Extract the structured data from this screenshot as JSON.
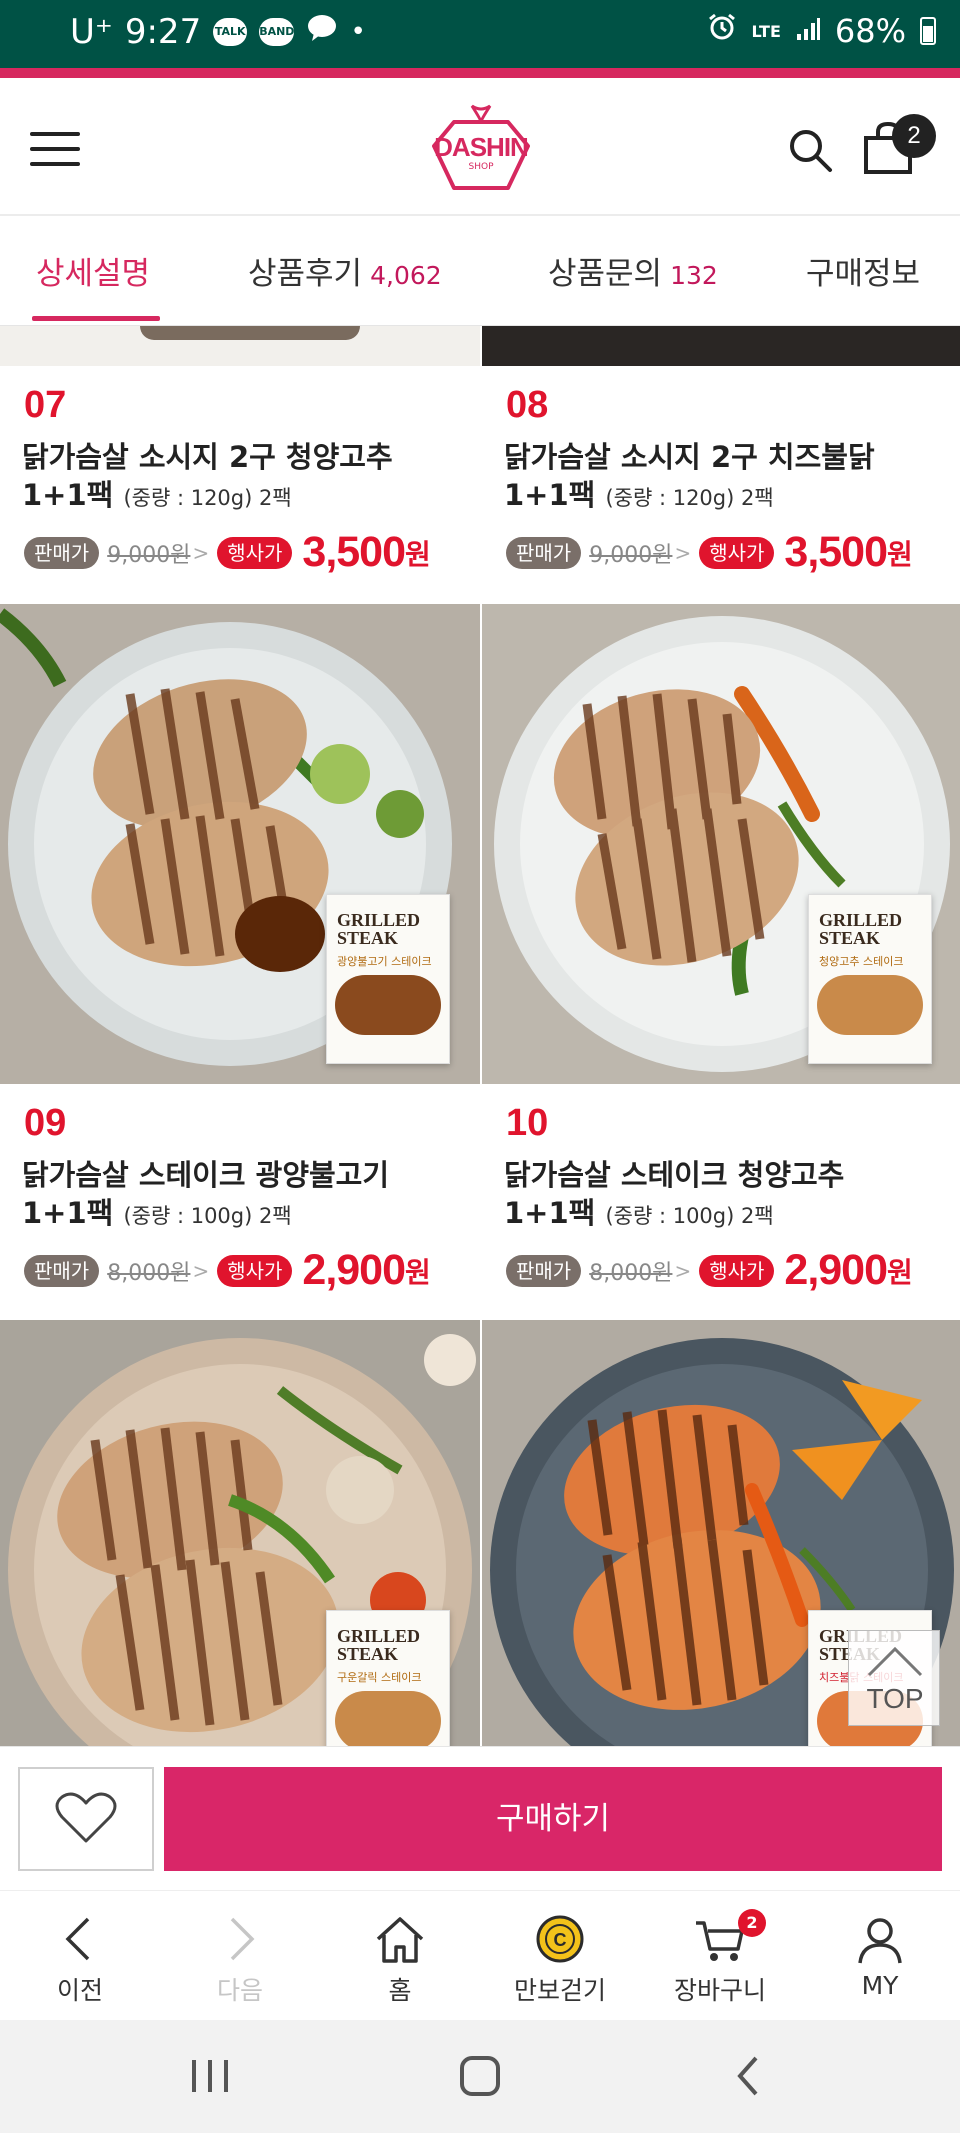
{
  "status_bar": {
    "carrier": "U⁺",
    "time": "9:27",
    "notif_chip_1": "TALK",
    "notif_chip_2": "BAND",
    "dot": "•",
    "network": "LTE",
    "battery": "68%",
    "icons": [
      "talk-icon",
      "band-icon",
      "chat-bubble-icon",
      "alarm-icon",
      "signal-icon",
      "battery-icon"
    ],
    "bg_color": "#005245"
  },
  "header": {
    "logo_text": "DASHIN",
    "logo_sub": "SHOP",
    "cart_count": "2",
    "icons": [
      "menu-icon",
      "search-icon",
      "shopping-bag-icon"
    ],
    "brand_color": "#d6285f"
  },
  "tabs": [
    {
      "label": "상세설명",
      "count": "",
      "active": true
    },
    {
      "label": "상품후기",
      "count": "4,062",
      "active": false
    },
    {
      "label": "상품문의",
      "count": "132",
      "active": false
    },
    {
      "label": "구매정보",
      "count": "",
      "active": false
    }
  ],
  "products": [
    {
      "number": "07",
      "name_line1": "닭가슴살 소시지 2구 청양고추",
      "name_line2": "1+1팩",
      "weight": "(중량 : 120g) 2팩",
      "tag_orig": "판매가",
      "orig_price": "9,000원",
      "tag_sale": "행사가",
      "sale_price": "3,500",
      "unit": "원"
    },
    {
      "number": "08",
      "name_line1": "닭가슴살 소시지 2구 치즈불닭",
      "name_line2": "1+1팩",
      "weight": "(중량 : 120g) 2팩",
      "tag_orig": "판매가",
      "orig_price": "9,000원",
      "tag_sale": "행사가",
      "sale_price": "3,500",
      "unit": "원"
    },
    {
      "number": "09",
      "name_line1": "닭가슴살 스테이크 광양불고기",
      "name_line2": "1+1팩",
      "weight": "(중량 : 100g) 2팩",
      "tag_orig": "판매가",
      "orig_price": "8,000원",
      "tag_sale": "행사가",
      "sale_price": "2,900",
      "unit": "원"
    },
    {
      "number": "10",
      "name_line1": "닭가슴살 스테이크 청양고추",
      "name_line2": "1+1팩",
      "weight": "(중량 : 100g) 2팩",
      "tag_orig": "판매가",
      "orig_price": "8,000원",
      "tag_sale": "행사가",
      "sale_price": "2,900",
      "unit": "원"
    }
  ],
  "product_images": [
    {
      "brand": "GRILLED STEAK",
      "flavor": "광양불고기 스테이크"
    },
    {
      "brand": "GRILLED STEAK",
      "flavor": "청양고추 스테이크"
    },
    {
      "brand": "GRILLED STEAK",
      "flavor": "구운갈릭 스테이크"
    },
    {
      "brand": "GRILLED STEAK",
      "flavor": "치즈불닭 스테이크"
    }
  ],
  "top_button": "TOP",
  "buy_bar": {
    "buy_label": "구매하기",
    "buy_color": "#d92668",
    "wish_icon": "heart-icon"
  },
  "bottom_nav": [
    {
      "label": "이전",
      "icon": "chevron-left-icon",
      "enabled": true
    },
    {
      "label": "다음",
      "icon": "chevron-right-icon",
      "enabled": false
    },
    {
      "label": "홈",
      "icon": "home-icon",
      "enabled": true
    },
    {
      "label": "만보걷기",
      "icon": "coin-icon",
      "enabled": true
    },
    {
      "label": "장바구니",
      "icon": "cart-icon",
      "enabled": true,
      "badge": "2"
    },
    {
      "label": "MY",
      "icon": "user-icon",
      "enabled": true
    }
  ],
  "system_nav": [
    "recents-icon",
    "home-circle-icon",
    "back-icon"
  ],
  "colors": {
    "accent_red": "#e0142d",
    "tab_active": "#d6285f"
  }
}
